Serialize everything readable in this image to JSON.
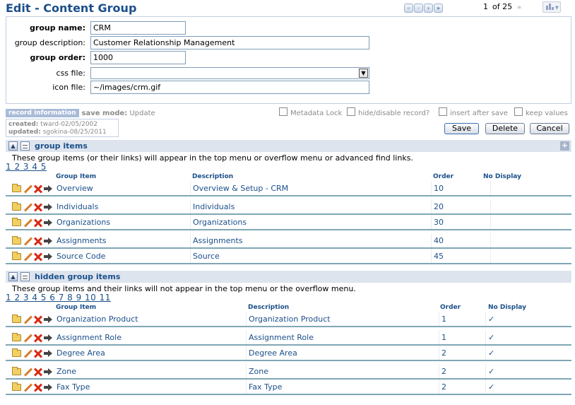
{
  "header": {
    "title": "Edit - Content Group",
    "pager": {
      "current": "1",
      "of_label": "of 25"
    }
  },
  "form": {
    "group_name": {
      "label": "group name:",
      "value": "CRM"
    },
    "group_description": {
      "label": "group description:",
      "value": "Customer Relationship Management"
    },
    "group_order": {
      "label": "group order:",
      "value": "1000"
    },
    "css_file": {
      "label": "css file:",
      "value": ""
    },
    "icon_file": {
      "label": "icon file:",
      "value": "~/images/crm.gif"
    }
  },
  "record_info": {
    "badge": "record information",
    "save_mode_label": "save mode:",
    "save_mode_value": "Update",
    "created_label": "created:",
    "created_value": "tward-02/05/2002",
    "updated_label": "updated:",
    "updated_value": "sgokina-08/25/2011"
  },
  "options": {
    "metadata_lock": "Metadata Lock",
    "hide_disable": "hide/disable record?",
    "insert_after_save": "insert after save",
    "keep_values": "keep values"
  },
  "buttons": {
    "save": "Save",
    "delete": "Delete",
    "cancel": "Cancel"
  },
  "group_items": {
    "title": "group items",
    "description": "These group items (or their links) will appear in the top menu or overflow menu or advanced find links.",
    "pages": "1 2 3 4 5",
    "columns": {
      "item": "Group Item",
      "description": "Description",
      "order": "Order",
      "no_display": "No Display"
    },
    "rows": [
      {
        "item": "Overview",
        "description": "Overview & Setup - CRM",
        "order": "10",
        "no_display": ""
      },
      {
        "item": "Individuals",
        "description": "Individuals",
        "order": "20",
        "no_display": ""
      },
      {
        "item": "Organizations",
        "description": "Organizations",
        "order": "30",
        "no_display": ""
      },
      {
        "item": "Assignments",
        "description": "Assignments",
        "order": "40",
        "no_display": ""
      },
      {
        "item": "Source Code",
        "description": "Source",
        "order": "45",
        "no_display": ""
      }
    ]
  },
  "hidden_items": {
    "title": "hidden group items",
    "description": "These group items and their links will not appear in the top menu or the overflow menu.",
    "pages": "1 2 3 4 5 6 7 8 9 10 11",
    "columns": {
      "item": "Group Item",
      "description": "Description",
      "order": "Order",
      "no_display": "No Display"
    },
    "rows": [
      {
        "item": "Organization Product",
        "description": "Organization Product",
        "order": "1",
        "no_display": "✓"
      },
      {
        "item": "Assignment Role",
        "description": "Assignment Role",
        "order": "1",
        "no_display": "✓"
      },
      {
        "item": "Degree Area",
        "description": "Degree Area",
        "order": "2",
        "no_display": "✓"
      },
      {
        "item": "Zone",
        "description": "Zone",
        "order": "2",
        "no_display": "✓"
      },
      {
        "item": "Fax Type",
        "description": "Fax Type",
        "order": "2",
        "no_display": "✓"
      }
    ]
  }
}
